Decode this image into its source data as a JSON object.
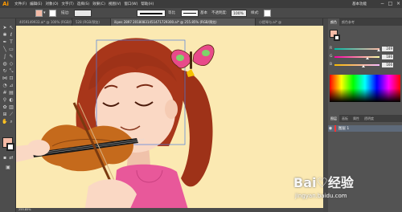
{
  "app": {
    "logo": "Ai"
  },
  "menu": [
    "文件(F)",
    "编辑(E)",
    "对象(O)",
    "文字(T)",
    "选择(S)",
    "效果(C)",
    "视图(V)",
    "窗口(W)",
    "帮助(H)"
  ],
  "workspace": "基本功能",
  "window_controls": [
    "−",
    "□",
    "×"
  ],
  "control_bar": {
    "fill_color": "#f4baa6",
    "stroke_label": "描边:",
    "stroke_value": "",
    "uniform_label": "等比",
    "basic_label": "基本",
    "opacity_label": "不透明度:",
    "opacity_value": "100%",
    "style_label": "样式:"
  },
  "doc_tabs": [
    {
      "label": "4059149933.ai* @ 100% (RGB/预览)",
      "active": false
    },
    {
      "label": "528 (RGB/预览)",
      "active": false
    },
    {
      "label": "ilipes 2897 20180831451471729300.ai* @ 255.85% (RGB/预览)",
      "active": true
    },
    {
      "label": "小提琴与.ai* @",
      "active": false
    }
  ],
  "tools": [
    "selection",
    "direct-selection",
    "magic-wand",
    "lasso",
    "pen",
    "type",
    "line",
    "rectangle",
    "paintbrush",
    "pencil",
    "blob-brush",
    "eraser",
    "rotate",
    "scale",
    "width",
    "free-transform",
    "shape-builder",
    "perspective",
    "mesh",
    "gradient",
    "eyedropper",
    "blend",
    "symbol",
    "graph",
    "artboard",
    "slice",
    "hand",
    "zoom"
  ],
  "colors": {
    "canvas_bg": "#fbe9b2",
    "skin": "#f9d6c2",
    "hair": "#9e3218",
    "violin": "#c56a1c",
    "dress": "#e8589a",
    "fill": "#f4baa6"
  },
  "panel": {
    "tabs": [
      "颜色",
      "颜色参考"
    ],
    "channels": [
      {
        "label": "R",
        "value": "249",
        "fraction": 0.98
      },
      {
        "label": "G",
        "value": "186",
        "fraction": 0.73
      },
      {
        "label": "B",
        "value": "166",
        "fraction": 0.65
      }
    ],
    "layers_tabs": [
      "图层",
      "画板",
      "属性",
      "透明度"
    ],
    "layer_name": "图层 1"
  },
  "status": {
    "zoom": "255.85%"
  },
  "watermark": {
    "brand": "Bai♡经验",
    "url": "jingyan.baidu.com"
  }
}
